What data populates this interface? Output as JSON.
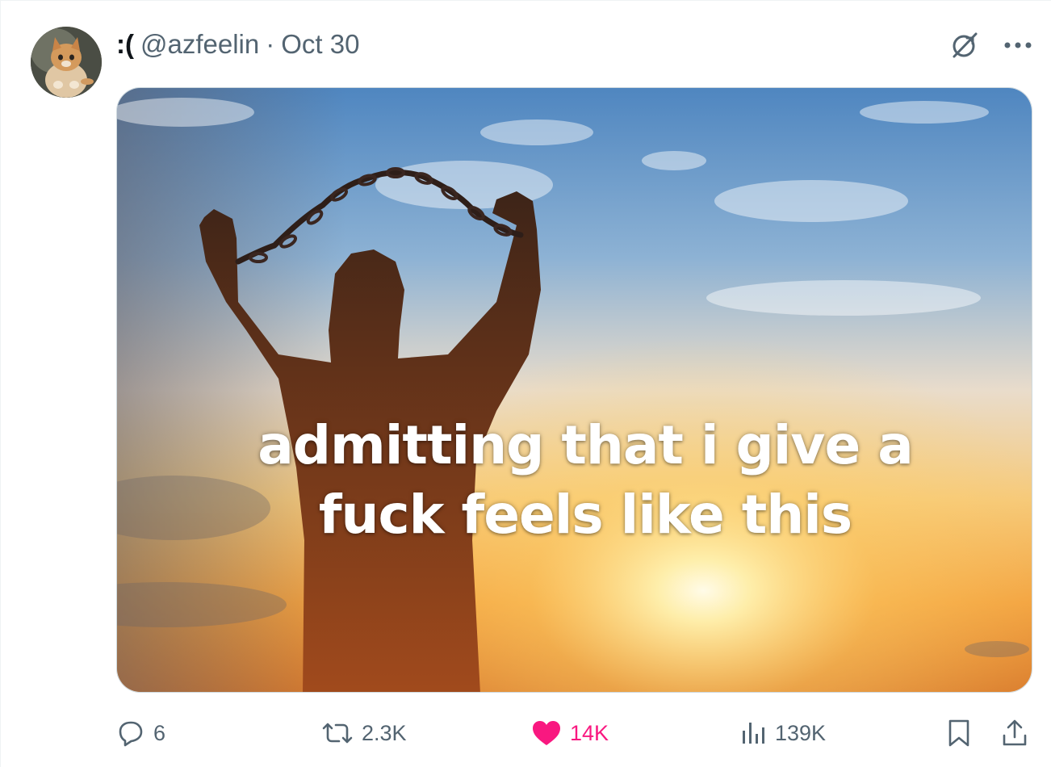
{
  "tweet": {
    "display_name": ":(",
    "handle": "@azfeelin",
    "separator": "·",
    "date": "Oct 30",
    "avatar": "kitten-avatar",
    "top_icons": [
      "grok-icon",
      "more-icon"
    ],
    "media": {
      "caption_line1": "admitting that i give a",
      "caption_line2": "fuck feels like this"
    },
    "actions": {
      "replies": "6",
      "reposts": "2.3K",
      "likes": "14K",
      "views": "139K",
      "bookmark_icon": "bookmark-icon",
      "share_icon": "share-icon"
    },
    "colors": {
      "text_primary": "#0f1419",
      "text_secondary": "#536471",
      "like_pink": "#f91880",
      "border": "#cfd9de"
    }
  }
}
